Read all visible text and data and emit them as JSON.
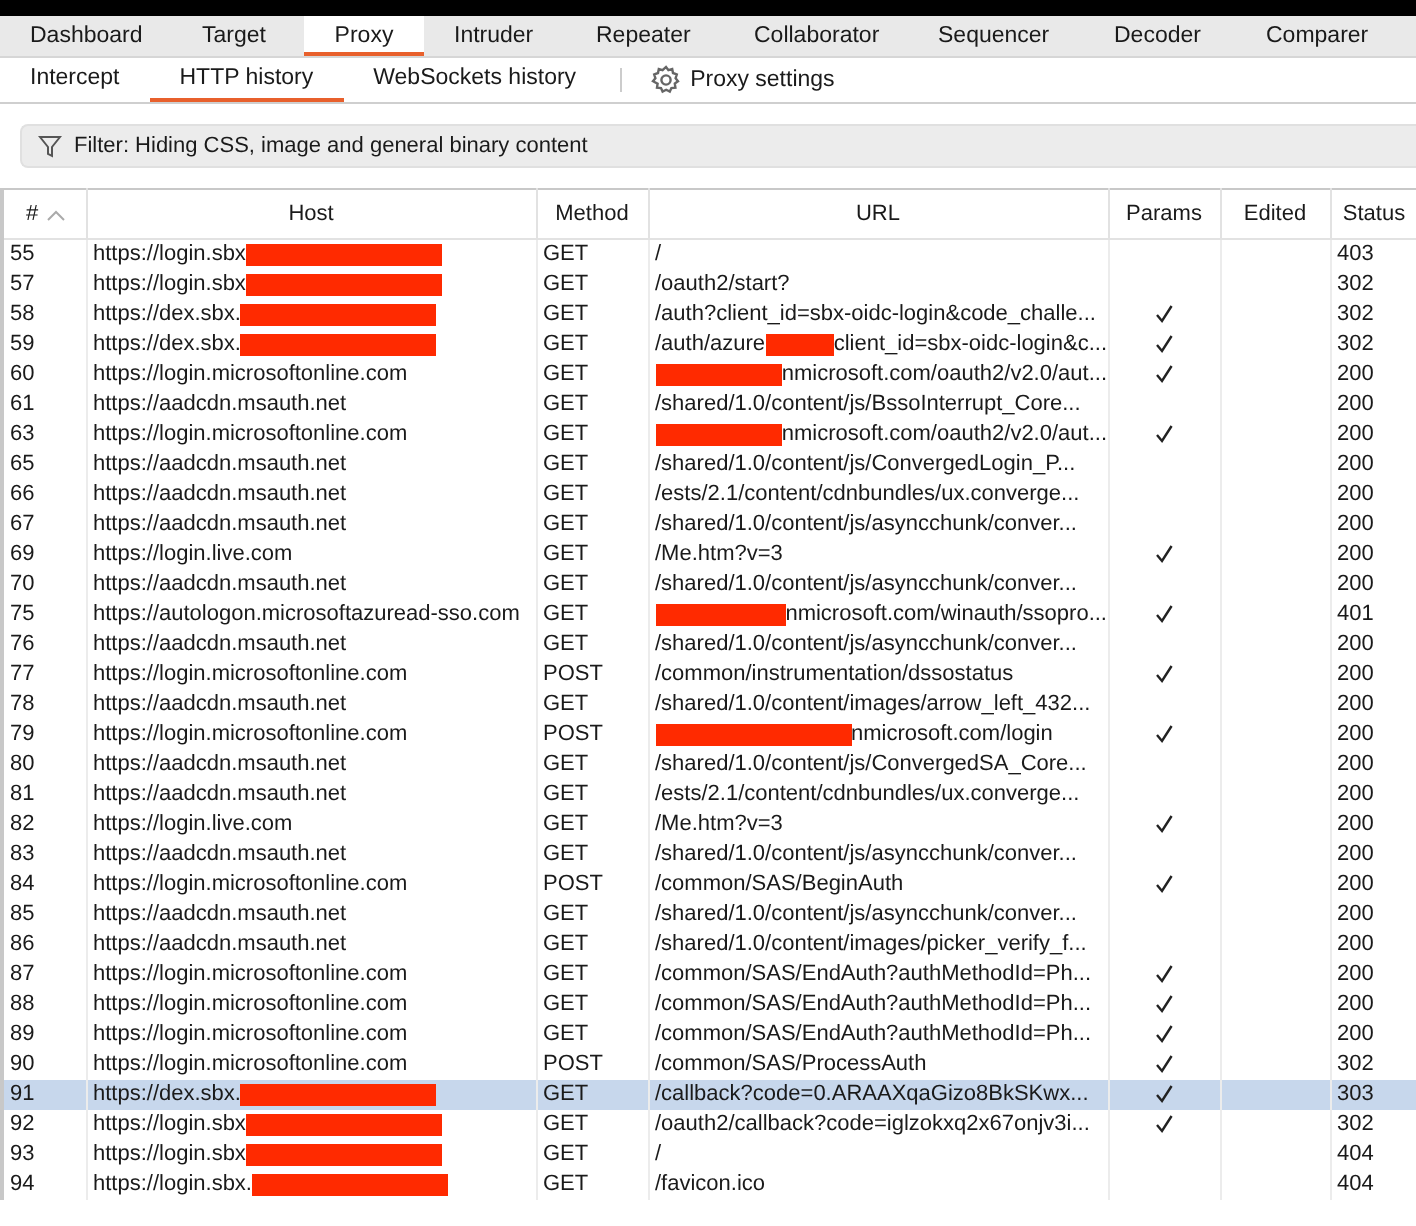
{
  "main_tabs": [
    {
      "label": "Dashboard",
      "selected": false
    },
    {
      "label": "Target",
      "selected": false
    },
    {
      "label": "Proxy",
      "selected": true
    },
    {
      "label": "Intruder",
      "selected": false
    },
    {
      "label": "Repeater",
      "selected": false
    },
    {
      "label": "Collaborator",
      "selected": false
    },
    {
      "label": "Sequencer",
      "selected": false
    },
    {
      "label": "Decoder",
      "selected": false
    },
    {
      "label": "Comparer",
      "selected": false
    }
  ],
  "sub_tabs": [
    {
      "label": "Intercept",
      "selected": false
    },
    {
      "label": "HTTP history",
      "selected": true
    },
    {
      "label": "WebSockets history",
      "selected": false
    }
  ],
  "settings_button": "Proxy settings",
  "filter": "Filter: Hiding CSS, image and general binary content",
  "table": {
    "columns": [
      "#",
      "Host",
      "Method",
      "URL",
      "Params",
      "Edited",
      "Status"
    ],
    "rows": [
      {
        "num": "55",
        "host": [
          {
            "kind": "text",
            "text": "https://login.sbx"
          },
          {
            "kind": "redaction"
          }
        ],
        "method": "GET",
        "url": [
          {
            "kind": "text",
            "text": "/"
          }
        ],
        "params": false,
        "status": "403",
        "selected": false
      },
      {
        "num": "57",
        "host": [
          {
            "kind": "text",
            "text": "https://login.sbx"
          },
          {
            "kind": "redaction"
          }
        ],
        "method": "GET",
        "url": [
          {
            "kind": "text",
            "text": "/oauth2/start?"
          }
        ],
        "params": false,
        "status": "302",
        "selected": false
      },
      {
        "num": "58",
        "host": [
          {
            "kind": "text",
            "text": "https://dex.sbx."
          },
          {
            "kind": "redaction"
          }
        ],
        "method": "GET",
        "url": [
          {
            "kind": "text",
            "text": "/auth?client_id=sbx-oidc-login&code_challe..."
          }
        ],
        "params": true,
        "status": "302",
        "selected": false
      },
      {
        "num": "59",
        "host": [
          {
            "kind": "text",
            "text": "https://dex.sbx."
          },
          {
            "kind": "redaction"
          }
        ],
        "method": "GET",
        "url": [
          {
            "kind": "text",
            "text": "/auth/azure"
          },
          {
            "kind": "redaction"
          },
          {
            "kind": "text",
            "text": "client_id=sbx-oidc-login&c..."
          }
        ],
        "params": true,
        "status": "302",
        "selected": false
      },
      {
        "num": "60",
        "host": [
          {
            "kind": "text",
            "text": "https://login.microsoftonline.com"
          }
        ],
        "method": "GET",
        "url": [
          {
            "kind": "redaction"
          },
          {
            "kind": "text",
            "text": "nmicrosoft.com/oauth2/v2.0/aut..."
          }
        ],
        "params": true,
        "status": "200",
        "selected": false
      },
      {
        "num": "61",
        "host": [
          {
            "kind": "text",
            "text": "https://aadcdn.msauth.net"
          }
        ],
        "method": "GET",
        "url": [
          {
            "kind": "text",
            "text": "/shared/1.0/content/js/BssoInterrupt_Core..."
          }
        ],
        "params": false,
        "status": "200",
        "selected": false
      },
      {
        "num": "63",
        "host": [
          {
            "kind": "text",
            "text": "https://login.microsoftonline.com"
          }
        ],
        "method": "GET",
        "url": [
          {
            "kind": "redaction"
          },
          {
            "kind": "text",
            "text": "nmicrosoft.com/oauth2/v2.0/aut..."
          }
        ],
        "params": true,
        "status": "200",
        "selected": false
      },
      {
        "num": "65",
        "host": [
          {
            "kind": "text",
            "text": "https://aadcdn.msauth.net"
          }
        ],
        "method": "GET",
        "url": [
          {
            "kind": "text",
            "text": "/shared/1.0/content/js/ConvergedLogin_P..."
          }
        ],
        "params": false,
        "status": "200",
        "selected": false
      },
      {
        "num": "66",
        "host": [
          {
            "kind": "text",
            "text": "https://aadcdn.msauth.net"
          }
        ],
        "method": "GET",
        "url": [
          {
            "kind": "text",
            "text": "/ests/2.1/content/cdnbundles/ux.converge..."
          }
        ],
        "params": false,
        "status": "200",
        "selected": false
      },
      {
        "num": "67",
        "host": [
          {
            "kind": "text",
            "text": "https://aadcdn.msauth.net"
          }
        ],
        "method": "GET",
        "url": [
          {
            "kind": "text",
            "text": "/shared/1.0/content/js/asyncchunk/conver..."
          }
        ],
        "params": false,
        "status": "200",
        "selected": false
      },
      {
        "num": "69",
        "host": [
          {
            "kind": "text",
            "text": "https://login.live.com"
          }
        ],
        "method": "GET",
        "url": [
          {
            "kind": "text",
            "text": "/Me.htm?v=3"
          }
        ],
        "params": true,
        "status": "200",
        "selected": false
      },
      {
        "num": "70",
        "host": [
          {
            "kind": "text",
            "text": "https://aadcdn.msauth.net"
          }
        ],
        "method": "GET",
        "url": [
          {
            "kind": "text",
            "text": "/shared/1.0/content/js/asyncchunk/conver..."
          }
        ],
        "params": false,
        "status": "200",
        "selected": false
      },
      {
        "num": "75",
        "host": [
          {
            "kind": "text",
            "text": "https://autologon.microsoftazuread-sso.com"
          }
        ],
        "method": "GET",
        "url": [
          {
            "kind": "redaction"
          },
          {
            "kind": "text",
            "text": "nmicrosoft.com/winauth/ssopro..."
          }
        ],
        "params": true,
        "status": "401",
        "selected": false
      },
      {
        "num": "76",
        "host": [
          {
            "kind": "text",
            "text": "https://aadcdn.msauth.net"
          }
        ],
        "method": "GET",
        "url": [
          {
            "kind": "text",
            "text": "/shared/1.0/content/js/asyncchunk/conver..."
          }
        ],
        "params": false,
        "status": "200",
        "selected": false
      },
      {
        "num": "77",
        "host": [
          {
            "kind": "text",
            "text": "https://login.microsoftonline.com"
          }
        ],
        "method": "POST",
        "url": [
          {
            "kind": "text",
            "text": "/common/instrumentation/dssostatus"
          }
        ],
        "params": true,
        "status": "200",
        "selected": false
      },
      {
        "num": "78",
        "host": [
          {
            "kind": "text",
            "text": "https://aadcdn.msauth.net"
          }
        ],
        "method": "GET",
        "url": [
          {
            "kind": "text",
            "text": "/shared/1.0/content/images/arrow_left_432..."
          }
        ],
        "params": false,
        "status": "200",
        "selected": false
      },
      {
        "num": "79",
        "host": [
          {
            "kind": "text",
            "text": "https://login.microsoftonline.com"
          }
        ],
        "method": "POST",
        "url": [
          {
            "kind": "redaction"
          },
          {
            "kind": "text",
            "text": "nmicrosoft.com/login"
          }
        ],
        "params": true,
        "status": "200",
        "selected": false
      },
      {
        "num": "80",
        "host": [
          {
            "kind": "text",
            "text": "https://aadcdn.msauth.net"
          }
        ],
        "method": "GET",
        "url": [
          {
            "kind": "text",
            "text": "/shared/1.0/content/js/ConvergedSA_Core..."
          }
        ],
        "params": false,
        "status": "200",
        "selected": false
      },
      {
        "num": "81",
        "host": [
          {
            "kind": "text",
            "text": "https://aadcdn.msauth.net"
          }
        ],
        "method": "GET",
        "url": [
          {
            "kind": "text",
            "text": "/ests/2.1/content/cdnbundles/ux.converge..."
          }
        ],
        "params": false,
        "status": "200",
        "selected": false
      },
      {
        "num": "82",
        "host": [
          {
            "kind": "text",
            "text": "https://login.live.com"
          }
        ],
        "method": "GET",
        "url": [
          {
            "kind": "text",
            "text": "/Me.htm?v=3"
          }
        ],
        "params": true,
        "status": "200",
        "selected": false
      },
      {
        "num": "83",
        "host": [
          {
            "kind": "text",
            "text": "https://aadcdn.msauth.net"
          }
        ],
        "method": "GET",
        "url": [
          {
            "kind": "text",
            "text": "/shared/1.0/content/js/asyncchunk/conver..."
          }
        ],
        "params": false,
        "status": "200",
        "selected": false
      },
      {
        "num": "84",
        "host": [
          {
            "kind": "text",
            "text": "https://login.microsoftonline.com"
          }
        ],
        "method": "POST",
        "url": [
          {
            "kind": "text",
            "text": "/common/SAS/BeginAuth"
          }
        ],
        "params": true,
        "status": "200",
        "selected": false
      },
      {
        "num": "85",
        "host": [
          {
            "kind": "text",
            "text": "https://aadcdn.msauth.net"
          }
        ],
        "method": "GET",
        "url": [
          {
            "kind": "text",
            "text": "/shared/1.0/content/js/asyncchunk/conver..."
          }
        ],
        "params": false,
        "status": "200",
        "selected": false
      },
      {
        "num": "86",
        "host": [
          {
            "kind": "text",
            "text": "https://aadcdn.msauth.net"
          }
        ],
        "method": "GET",
        "url": [
          {
            "kind": "text",
            "text": "/shared/1.0/content/images/picker_verify_f..."
          }
        ],
        "params": false,
        "status": "200",
        "selected": false
      },
      {
        "num": "87",
        "host": [
          {
            "kind": "text",
            "text": "https://login.microsoftonline.com"
          }
        ],
        "method": "GET",
        "url": [
          {
            "kind": "text",
            "text": "/common/SAS/EndAuth?authMethodId=Ph..."
          }
        ],
        "params": true,
        "status": "200",
        "selected": false
      },
      {
        "num": "88",
        "host": [
          {
            "kind": "text",
            "text": "https://login.microsoftonline.com"
          }
        ],
        "method": "GET",
        "url": [
          {
            "kind": "text",
            "text": "/common/SAS/EndAuth?authMethodId=Ph..."
          }
        ],
        "params": true,
        "status": "200",
        "selected": false
      },
      {
        "num": "89",
        "host": [
          {
            "kind": "text",
            "text": "https://login.microsoftonline.com"
          }
        ],
        "method": "GET",
        "url": [
          {
            "kind": "text",
            "text": "/common/SAS/EndAuth?authMethodId=Ph..."
          }
        ],
        "params": true,
        "status": "200",
        "selected": false
      },
      {
        "num": "90",
        "host": [
          {
            "kind": "text",
            "text": "https://login.microsoftonline.com"
          }
        ],
        "method": "POST",
        "url": [
          {
            "kind": "text",
            "text": "/common/SAS/ProcessAuth"
          }
        ],
        "params": true,
        "status": "302",
        "selected": false
      },
      {
        "num": "91",
        "host": [
          {
            "kind": "text",
            "text": "https://dex.sbx."
          },
          {
            "kind": "redaction"
          }
        ],
        "method": "GET",
        "url": [
          {
            "kind": "text",
            "text": "/callback?code=0.ARAAXqaGizo8BkSKwx..."
          }
        ],
        "params": true,
        "status": "303",
        "selected": true
      },
      {
        "num": "92",
        "host": [
          {
            "kind": "text",
            "text": "https://login.sbx"
          },
          {
            "kind": "redaction"
          }
        ],
        "method": "GET",
        "url": [
          {
            "kind": "text",
            "text": "/oauth2/callback?code=iglzokxq2x67onjv3i..."
          }
        ],
        "params": true,
        "status": "302",
        "selected": false
      },
      {
        "num": "93",
        "host": [
          {
            "kind": "text",
            "text": "https://login.sbx"
          },
          {
            "kind": "redaction"
          }
        ],
        "method": "GET",
        "url": [
          {
            "kind": "text",
            "text": "/"
          }
        ],
        "params": false,
        "status": "404",
        "selected": false
      },
      {
        "num": "94",
        "host": [
          {
            "kind": "text",
            "text": "https://login.sbx."
          },
          {
            "kind": "redaction"
          }
        ],
        "method": "GET",
        "url": [
          {
            "kind": "text",
            "text": "/favicon.ico"
          }
        ],
        "params": false,
        "status": "404",
        "selected": false
      }
    ]
  }
}
